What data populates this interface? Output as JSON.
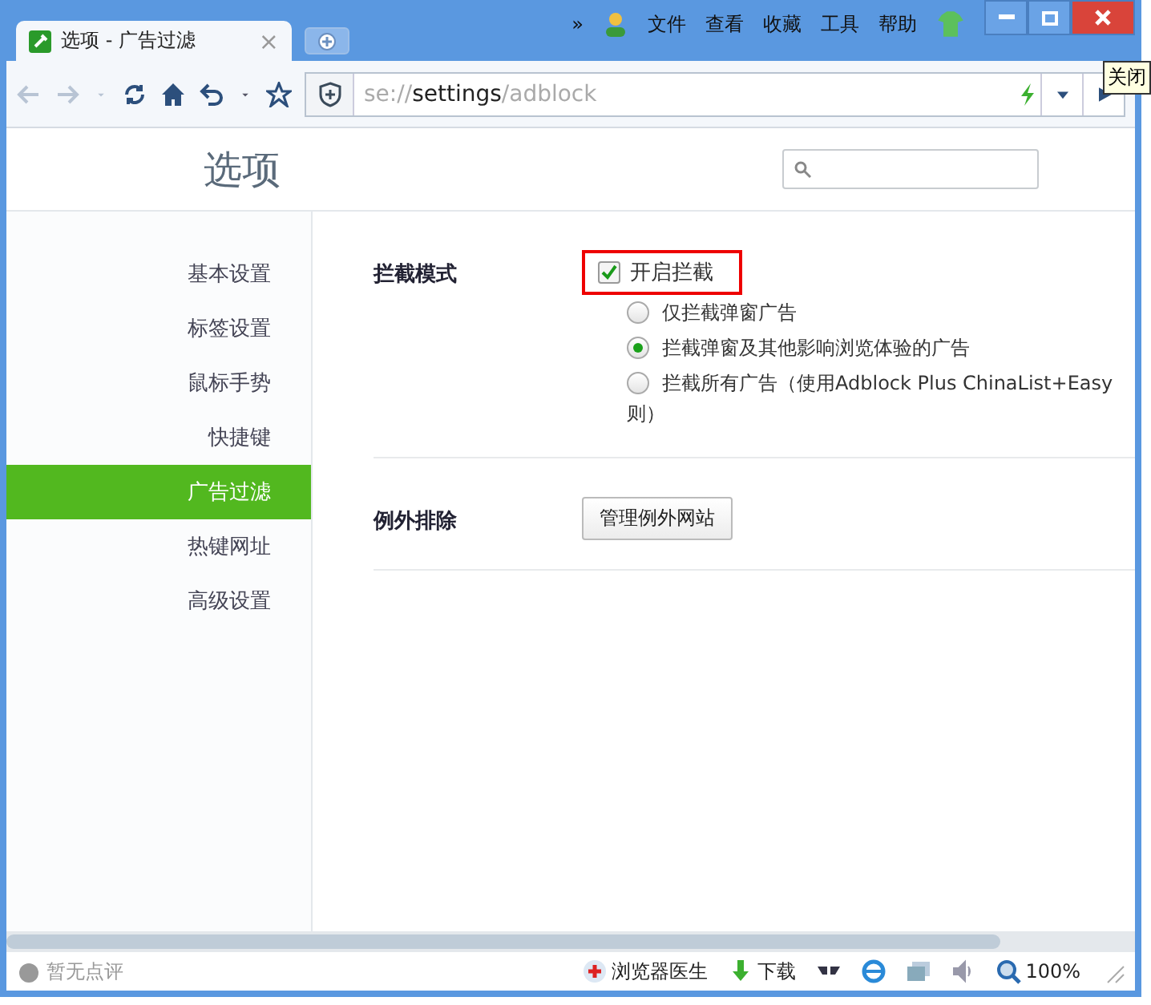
{
  "tab": {
    "title": "选项 - 广告过滤",
    "close": "×"
  },
  "menu": {
    "more": "»",
    "items": [
      "文件",
      "查看",
      "收藏",
      "工具",
      "帮助"
    ]
  },
  "tooltip": "关闭",
  "address": {
    "scheme": "se://",
    "host": "settings",
    "path": "/adblock"
  },
  "header": {
    "title": "选项"
  },
  "sidebar": {
    "items": [
      {
        "label": "基本设置",
        "selected": false
      },
      {
        "label": "标签设置",
        "selected": false
      },
      {
        "label": "鼠标手势",
        "selected": false
      },
      {
        "label": "快捷键",
        "selected": false
      },
      {
        "label": "广告过滤",
        "selected": true
      },
      {
        "label": "热键网址",
        "selected": false
      },
      {
        "label": "高级设置",
        "selected": false
      }
    ]
  },
  "sections": [
    {
      "label": "拦截模式",
      "kind": "options",
      "checkbox": {
        "label": "开启拦截",
        "checked": true,
        "highlighted": true
      },
      "options": [
        {
          "label": "仅拦截弹窗广告",
          "selected": false
        },
        {
          "label": "拦截弹窗及其他影响浏览体验的广告",
          "selected": true
        },
        {
          "label": "拦截所有广告（使用Adblock Plus ChinaList+Easy",
          "wrap": "则）",
          "selected": false
        }
      ]
    },
    {
      "label": "例外排除",
      "kind": "button",
      "button": "管理例外网站"
    }
  ],
  "status": {
    "rating": "暂无点评",
    "doctor": "浏览器医生",
    "download": "下载",
    "zoom": "100%"
  }
}
